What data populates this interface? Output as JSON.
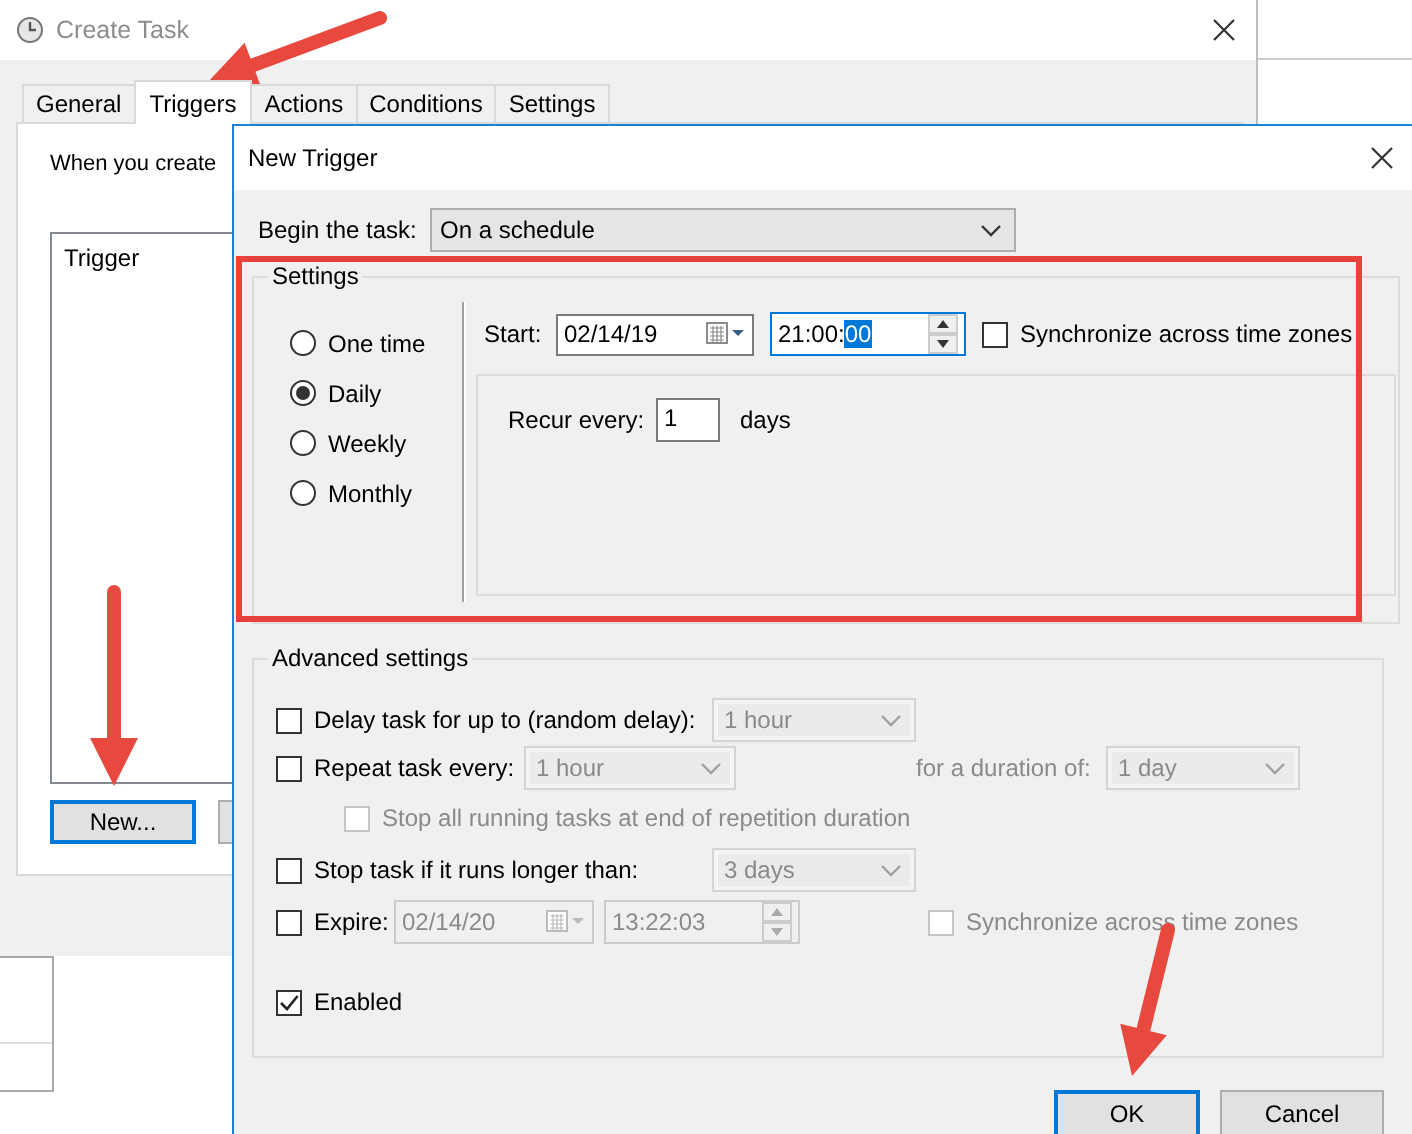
{
  "background_window": {
    "title": "Create Task",
    "tabs": [
      {
        "label": "General",
        "selected": false
      },
      {
        "label": "Triggers",
        "selected": true
      },
      {
        "label": "Actions",
        "selected": false
      },
      {
        "label": "Conditions",
        "selected": false
      },
      {
        "label": "Settings",
        "selected": false
      }
    ],
    "description": "When you create",
    "list_header": "Trigger",
    "buttons": [
      "New..."
    ]
  },
  "dialog": {
    "title": "New Trigger",
    "begin_label": "Begin the task:",
    "begin_value": "On a schedule",
    "settings": {
      "legend": "Settings",
      "schedule_options": [
        {
          "label": "One time",
          "selected": false
        },
        {
          "label": "Daily",
          "selected": true
        },
        {
          "label": "Weekly",
          "selected": false
        },
        {
          "label": "Monthly",
          "selected": false
        }
      ],
      "start_label": "Start:",
      "start_date": "02/14/19",
      "start_time": {
        "text": "21:00:",
        "selected_text": "00"
      },
      "sync": {
        "label": "Synchronize across time zones",
        "checked": false
      },
      "recur_label": "Recur every:",
      "recur_value": "1",
      "recur_unit": "days"
    },
    "advanced": {
      "legend": "Advanced settings",
      "delay": {
        "label": "Delay task for up to (random delay):",
        "checked": false,
        "combo": {
          "value": "1 hour",
          "disabled": true
        }
      },
      "repeat": {
        "label": "Repeat task every:",
        "checked": false,
        "combo": {
          "value": "1 hour",
          "disabled": true
        },
        "duration_label": {
          "text": "for a duration of:",
          "disabled": true
        },
        "duration_combo": {
          "value": "1 day",
          "disabled": true
        }
      },
      "stop_all": {
        "label": "Stop all running tasks at end of repetition duration",
        "checked": false,
        "disabled": true
      },
      "stop_task": {
        "label": "Stop task if it runs longer than:",
        "checked": false,
        "combo": {
          "value": "3 days",
          "disabled": true
        }
      },
      "expire": {
        "label": "Expire:",
        "checked": false,
        "date": {
          "value": "02/14/20",
          "disabled": true
        },
        "time": {
          "value": "13:22:03",
          "disabled": true
        },
        "sync": {
          "label": "Synchronize across time zones",
          "checked": false,
          "disabled": true
        }
      },
      "enabled": {
        "label": "Enabled",
        "checked": true
      }
    },
    "buttons": [
      {
        "label": "OK",
        "default": true
      },
      {
        "label": "Cancel",
        "default": false
      }
    ]
  }
}
